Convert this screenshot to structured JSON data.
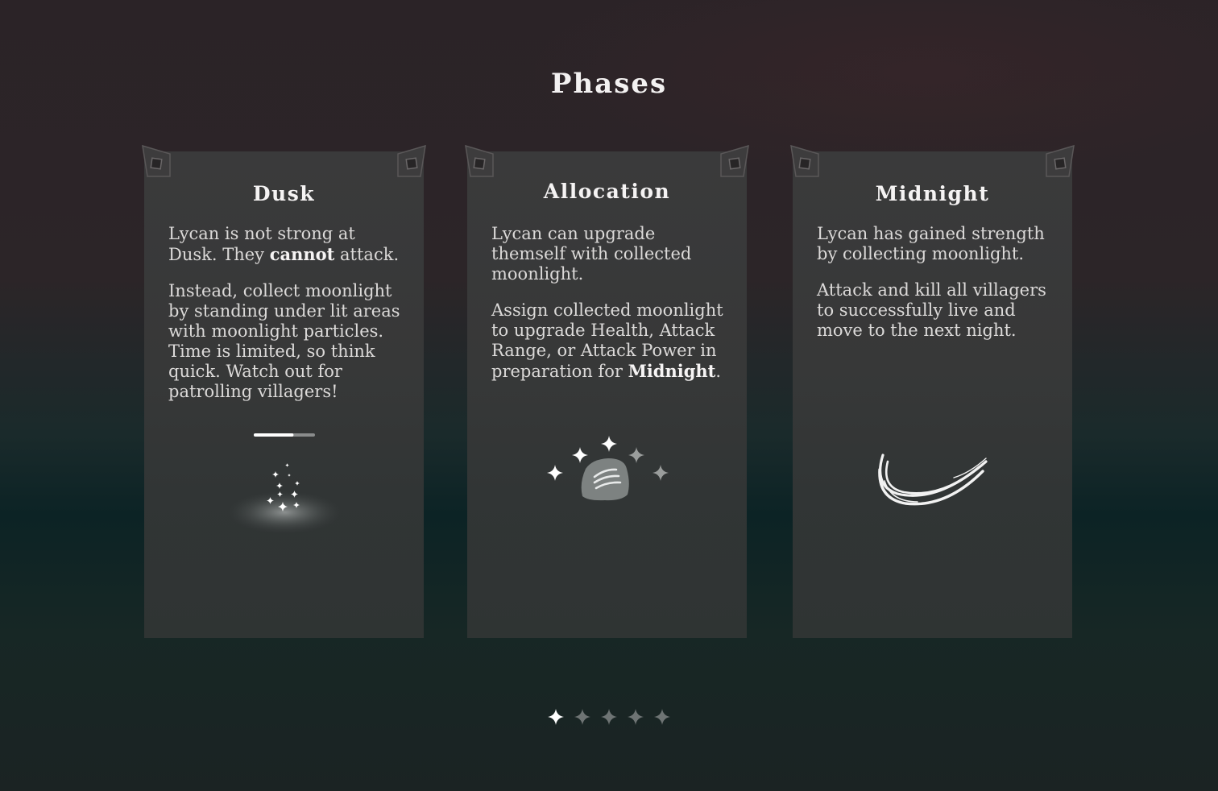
{
  "header": {
    "title": "Phases"
  },
  "cards": [
    {
      "title": "Dusk",
      "p1_a": "Lycan is not strong at Dusk. They ",
      "p1_bold": "cannot",
      "p1_b": " attack.",
      "p2": "Instead, collect moonlight by standing under lit areas with moonlight particles. Time is limited, so think quick. Watch out for patrolling villagers!",
      "icon": "moonlight-particles-icon",
      "progress": 0.65
    },
    {
      "title": "Allocation",
      "p1": "Lycan can upgrade themself with collected moonlight.",
      "p2_a": "Assign collected moonlight to upgrade Health, Attack Range, or Attack Power in preparation for ",
      "p2_bold": "Midnight",
      "p2_b": ".",
      "icon": "claw-stone-sparkles-icon"
    },
    {
      "title": "Midnight",
      "p1": "Lycan has gained strength by collecting moonlight.",
      "p2": "Attack and kill all villagers to successfully live and move to the next night.",
      "icon": "claw-slash-icon"
    }
  ],
  "pager": {
    "count": 5,
    "active": 0
  },
  "colors": {
    "card": "#373838",
    "text": "#dcdad9",
    "accent": "#ffffff"
  }
}
